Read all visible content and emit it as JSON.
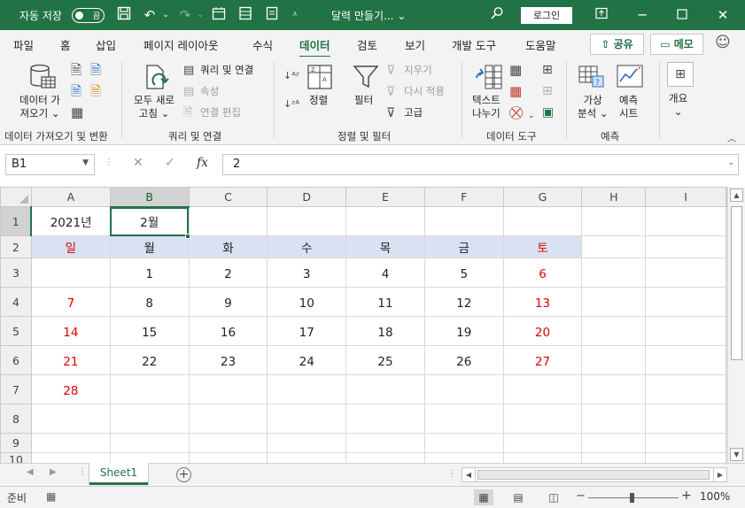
{
  "titlebar": {
    "autosave_label": "자동 저장",
    "autosave_state": "끔",
    "title": "달력 만들기...",
    "title_chevron": "⌄",
    "login_label": "로그인",
    "color": "#217346"
  },
  "tabs": [
    "파일",
    "홈",
    "삽입",
    "페이지 레이아웃",
    "수식",
    "데이터",
    "검토",
    "보기",
    "개발 도구",
    "도움말"
  ],
  "active_tab": "데이터",
  "share_label": "공유",
  "memo_label": "메모",
  "ribbon": {
    "get_data_line1": "데이터 가",
    "get_data_line2": "져오기",
    "get_data_group": "데이터 가져오기 및 변환",
    "refresh_all_line1": "모두 새로",
    "refresh_all_line2": "고침",
    "queries_connections": "쿼리 및 연결",
    "properties": "속성",
    "edit_links": "연결 편집",
    "queries_group": "쿼리 및 연결",
    "sort": "정렬",
    "filter": "필터",
    "clear": "지우기",
    "reapply": "다시 적용",
    "advanced": "고급",
    "sort_filter_group": "정렬 및 필터",
    "text_to_columns_line1": "텍스트",
    "text_to_columns_line2": "나누기",
    "data_tools_group": "데이터 도구",
    "whatif_line1": "가상",
    "whatif_line2": "분석",
    "forecast_line1": "예측",
    "forecast_line2": "시트",
    "forecast_group": "예측",
    "outline": "개요"
  },
  "formula_bar": {
    "name_box": "B1",
    "formula": "2",
    "fx": "fx"
  },
  "grid": {
    "columns": [
      "A",
      "B",
      "C",
      "D",
      "E",
      "F",
      "G",
      "H",
      "I"
    ],
    "selected_column": "B",
    "rows": [
      {
        "num": "1",
        "cells": [
          "2021년",
          "2월",
          "",
          "",
          "",
          "",
          "",
          "",
          ""
        ]
      },
      {
        "num": "2",
        "cells": [
          "일",
          "월",
          "화",
          "수",
          "목",
          "금",
          "토",
          "",
          ""
        ]
      },
      {
        "num": "3",
        "cells": [
          "",
          "1",
          "2",
          "3",
          "4",
          "5",
          "6",
          "",
          ""
        ]
      },
      {
        "num": "4",
        "cells": [
          "7",
          "8",
          "9",
          "10",
          "11",
          "12",
          "13",
          "",
          ""
        ]
      },
      {
        "num": "5",
        "cells": [
          "14",
          "15",
          "16",
          "17",
          "18",
          "19",
          "20",
          "",
          ""
        ]
      },
      {
        "num": "6",
        "cells": [
          "21",
          "22",
          "23",
          "24",
          "25",
          "26",
          "27",
          "",
          ""
        ]
      },
      {
        "num": "7",
        "cells": [
          "28",
          "",
          "",
          "",
          "",
          "",
          "",
          "",
          ""
        ]
      },
      {
        "num": "8",
        "cells": [
          "",
          "",
          "",
          "",
          "",
          "",
          "",
          "",
          ""
        ]
      },
      {
        "num": "9",
        "cells": [
          "",
          "",
          "",
          "",
          "",
          "",
          "",
          "",
          ""
        ]
      },
      {
        "num": "10",
        "cells": [
          "",
          "",
          "",
          "",
          "",
          "",
          "",
          "",
          ""
        ]
      }
    ],
    "weekend_color": "#e00000",
    "day_header_fill": "#d9e1f2"
  },
  "sheet_tab": "Sheet1",
  "status": {
    "ready": "준비",
    "zoom": "100%"
  }
}
